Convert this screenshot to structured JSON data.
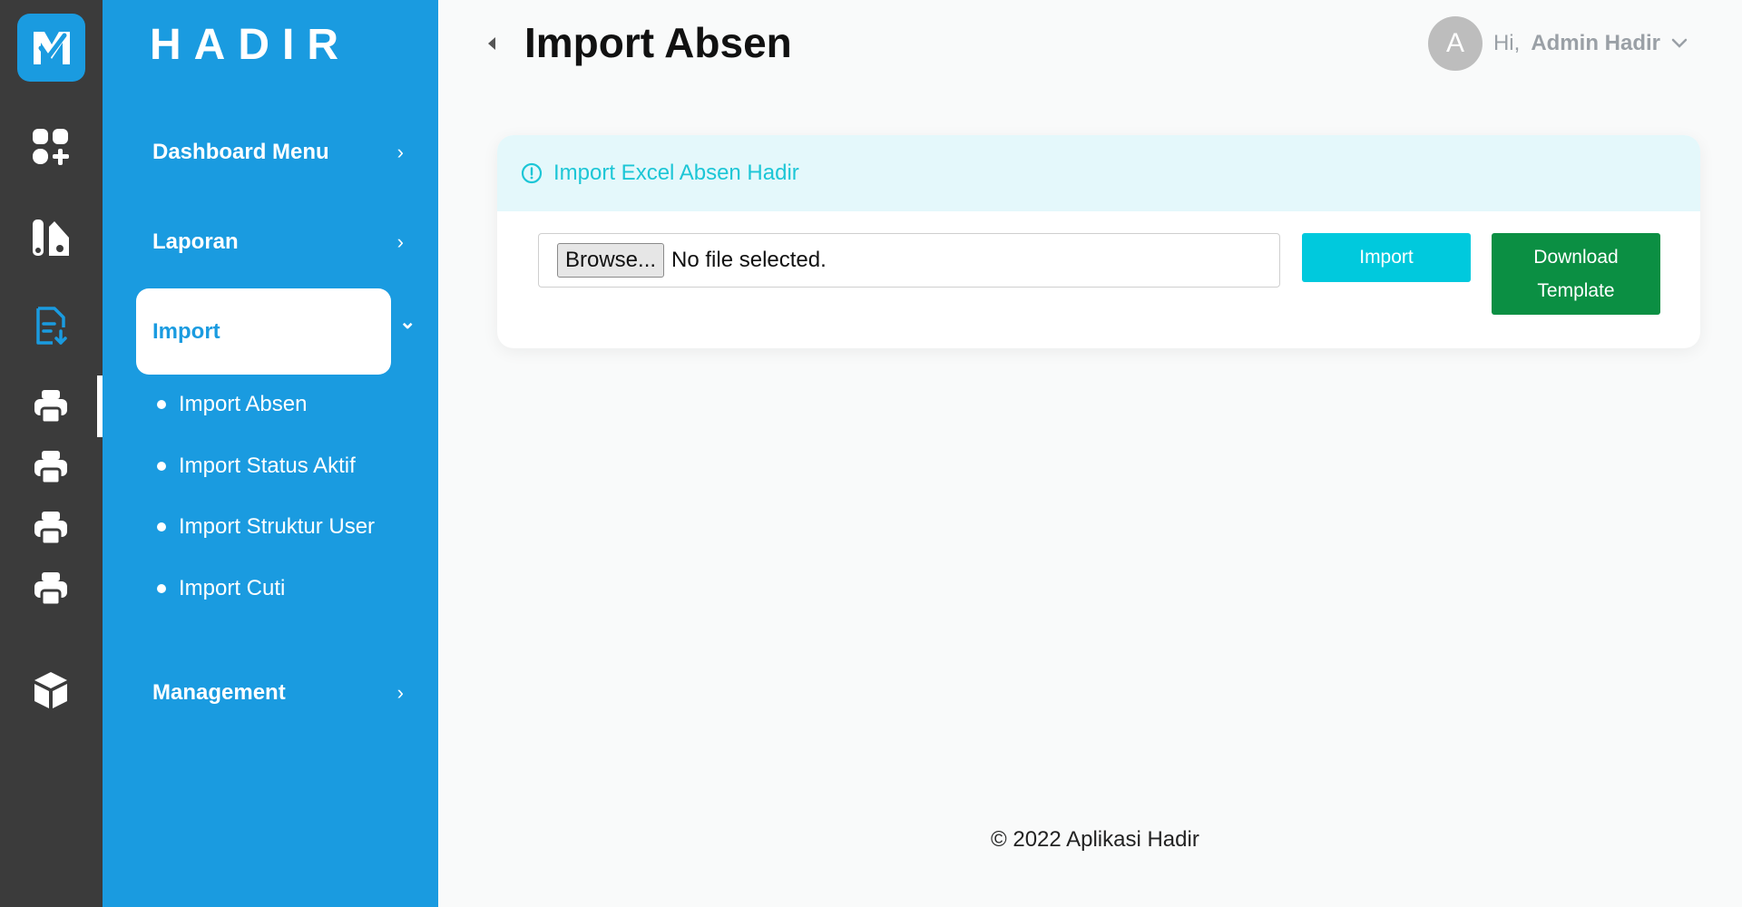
{
  "app": {
    "brand": "HADIR"
  },
  "rail": {
    "icons": [
      "logo-icon",
      "dashboard-grid-icon",
      "report-icon",
      "import-document-icon",
      "printer-icon",
      "printer-icon",
      "printer-icon",
      "printer-icon",
      "box-icon"
    ]
  },
  "sidebar": {
    "items": [
      {
        "label": "Dashboard Menu",
        "chevron": "›"
      },
      {
        "label": "Laporan",
        "chevron": "›"
      },
      {
        "label": "Import",
        "chevron": "⌄"
      },
      {
        "label": "Management",
        "chevron": "›"
      }
    ],
    "sub_items": [
      {
        "label": "Import Absen"
      },
      {
        "label": "Import Status Aktif"
      },
      {
        "label": "Import Struktur User"
      },
      {
        "label": "Import Cuti"
      }
    ]
  },
  "header": {
    "title": "Import Absen",
    "greeting": "Hi,",
    "user_name": "Admin Hadir",
    "avatar_letter": "A"
  },
  "card": {
    "title": "Import Excel Absen Hadir",
    "browse_label": "Browse...",
    "file_status": "No file selected.",
    "import_label": "Import",
    "download_line1": "Download",
    "download_line2": "Template"
  },
  "footer": {
    "text": "© 2022 Aplikasi Hadir"
  },
  "colors": {
    "primary": "#1a9be0",
    "rail": "#3b3b3b",
    "import_button": "#00c9dd",
    "download_button": "#0b8f43",
    "info_text": "#1cc6d6",
    "info_bg": "#e4f8fb"
  }
}
